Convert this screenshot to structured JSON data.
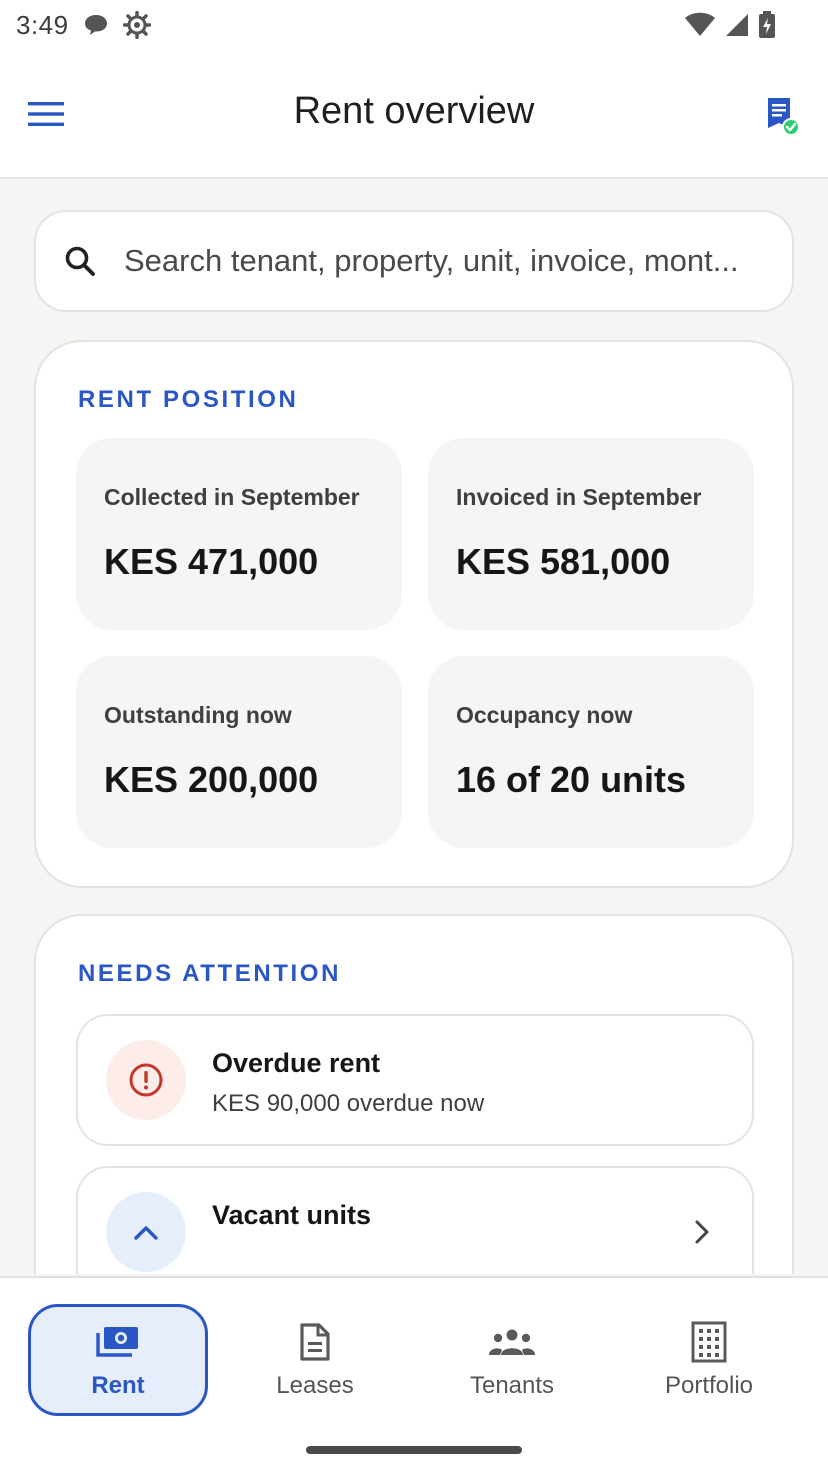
{
  "status_bar": {
    "time": "3:49",
    "icons": [
      "chat-bubble-icon",
      "settings-gear-icon",
      "wifi-icon",
      "cell-signal-icon",
      "battery-charging-icon"
    ]
  },
  "app_bar": {
    "title": "Rent overview",
    "menu_icon": "hamburger-menu-icon",
    "action_icon": "document-check-icon"
  },
  "search": {
    "placeholder": "Search tenant, property, unit, invoice, mont..."
  },
  "rent_position": {
    "title": "RENT POSITION",
    "tiles": [
      {
        "label": "Collected in September",
        "value": "KES 471,000"
      },
      {
        "label": "Invoiced in September",
        "value": "KES 581,000"
      },
      {
        "label": "Outstanding now",
        "value": "KES 200,000"
      },
      {
        "label": "Occupancy now",
        "value": "16 of 20 units"
      }
    ]
  },
  "needs_attention": {
    "title": "NEEDS ATTENTION",
    "items": [
      {
        "title": "Overdue rent",
        "subtitle": "KES 90,000 overdue now",
        "icon": "alert-circle-icon"
      },
      {
        "title": "Vacant units",
        "subtitle": "",
        "icon": "chevron-up-icon"
      }
    ]
  },
  "bottom_nav": {
    "items": [
      {
        "label": "Rent",
        "icon": "cash-icon",
        "active": true
      },
      {
        "label": "Leases",
        "icon": "document-icon",
        "active": false
      },
      {
        "label": "Tenants",
        "icon": "people-icon",
        "active": false
      },
      {
        "label": "Portfolio",
        "icon": "building-icon",
        "active": false
      }
    ]
  },
  "colors": {
    "accent": "#2b56c6",
    "alert": "#c0392b",
    "alert_bg": "#fdecea",
    "success": "#2ecc71"
  }
}
